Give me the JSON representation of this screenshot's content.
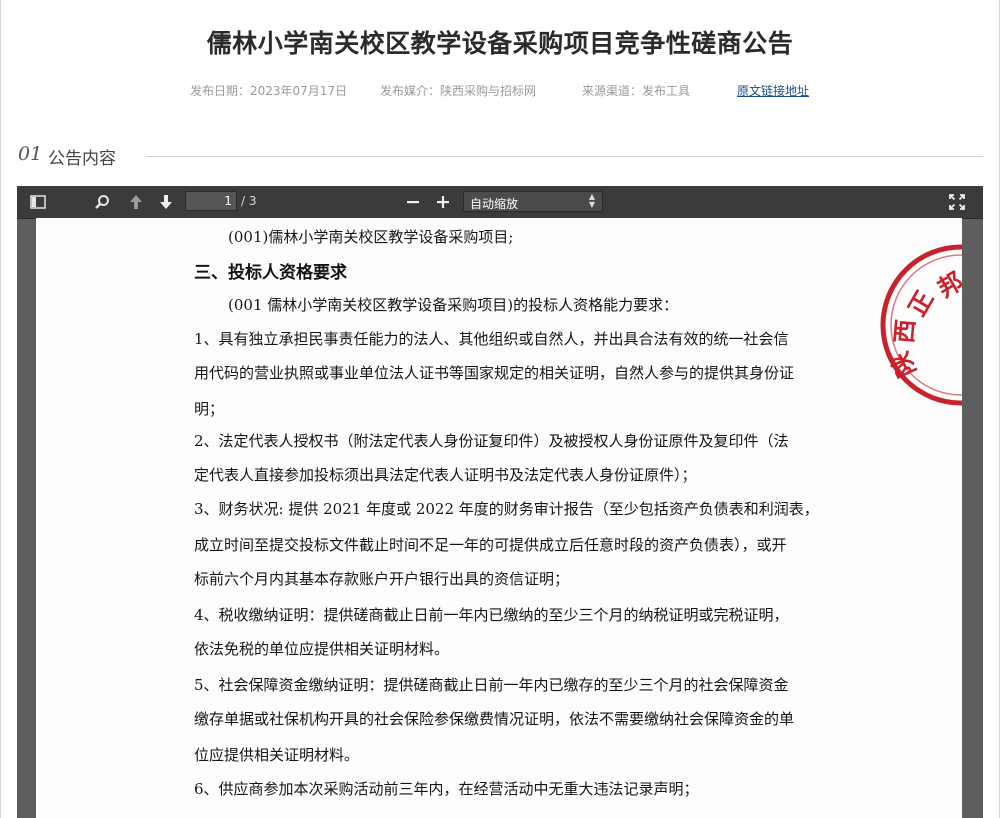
{
  "page_title": "儒林小学南关校区教学设备采购项目竞争性磋商公告",
  "meta": {
    "publish_date": "发布日期：2023年07月17日",
    "media": "发布媒介：陕西采购与招标网",
    "source": "来源渠道：发布工具",
    "original_link": "原文链接地址"
  },
  "section": {
    "number": "01",
    "label": "公告内容"
  },
  "pdf_viewer": {
    "page_current": "1",
    "page_total": "/ 3",
    "zoom_label": "自动缩放",
    "icons": [
      "sidebar-toggle-icon",
      "search-icon",
      "arrow-up-icon",
      "arrow-down-icon",
      "minus-icon",
      "plus-icon",
      "fullscreen-icon"
    ]
  },
  "document": {
    "lines": [
      "(001)儒林小学南关校区教学设备采购项目;",
      "三、投标人资格要求",
      "(001 儒林小学南关校区教学设备采购项目)的投标人资格能力要求：",
      "1、具有独立承担民事责任能力的法人、其他组织或自然人，并出具合法有效的统一社会信",
      "用代码的营业执照或事业单位法人证书等国家规定的相关证明，自然人参与的提供其身份证",
      "明；",
      "2、法定代表人授权书（附法定代表人身份证复印件）及被授权人身份证原件及复印件（法",
      "定代表人直接参加投标须出具法定代表人证明书及法定代表人身份证原件）；",
      "3、财务状况: 提供 2021 年度或 2022 年度的财务审计报告（至少包括资产负债表和利润表，",
      "成立时间至提交投标文件截止时间不足一年的可提供成立后任意时段的资产负债表），或开",
      "标前六个月内其基本存款账户开户银行出具的资信证明；",
      "4、税收缴纳证明：提供磋商截止日前一年内已缴纳的至少三个月的纳税证明或完税证明，",
      "依法免税的单位应提供相关证明材料。",
      "5、社会保障资金缴纳证明：提供磋商截止日前一年内已缴存的至少三个月的社会保障资金",
      "缴存单据或社保机构开具的社会保险参保缴费情况证明，依法不需要缴纳社会保障资金的单",
      "位应提供相关证明材料。",
      "6、供应商参加本次采购活动前三年内，在经营活动中无重大违法记录声明；"
    ],
    "seal_text": "陕西正邦招"
  },
  "colors": {
    "seal_red": "#c8232c",
    "toolbar": "#3b3b3b",
    "viewer_bg": "#5e5e5e",
    "link": "#1a4f8b"
  }
}
